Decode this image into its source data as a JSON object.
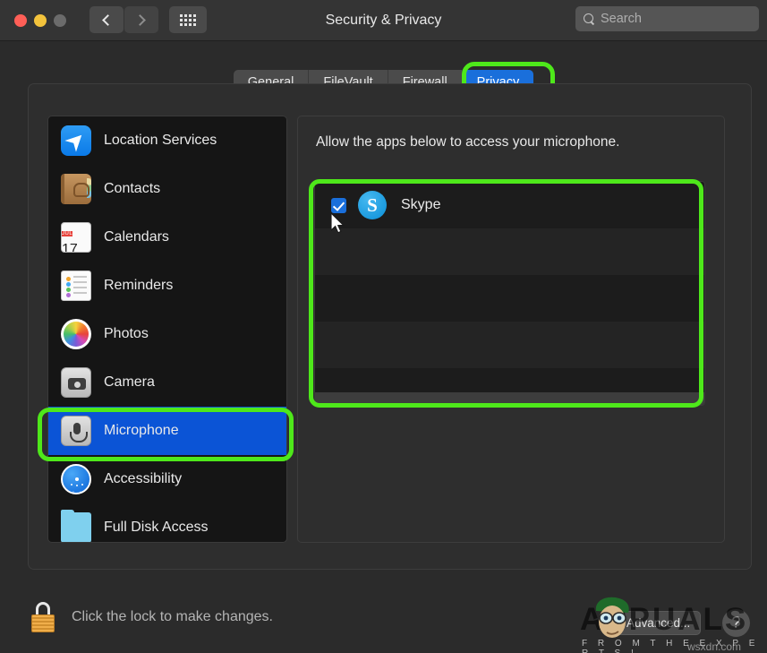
{
  "window": {
    "title": "Security & Privacy",
    "traffic_lights": [
      "close",
      "minimize",
      "zoom"
    ],
    "back_label": "Back",
    "forward_label": "Forward",
    "grid_label": "Show All"
  },
  "search": {
    "placeholder": "Search",
    "value": ""
  },
  "tabs": [
    {
      "label": "General",
      "active": false
    },
    {
      "label": "FileVault",
      "active": false
    },
    {
      "label": "Firewall",
      "active": false
    },
    {
      "label": "Privacy",
      "active": true
    }
  ],
  "sidebar": {
    "items": [
      {
        "label": "Location Services",
        "icon": "location-arrow-icon",
        "selected": false
      },
      {
        "label": "Contacts",
        "icon": "contacts-book-icon",
        "selected": false
      },
      {
        "label": "Calendars",
        "icon": "calendar-icon",
        "selected": false
      },
      {
        "label": "Reminders",
        "icon": "reminders-list-icon",
        "selected": false
      },
      {
        "label": "Photos",
        "icon": "photos-pinwheel-icon",
        "selected": false
      },
      {
        "label": "Camera",
        "icon": "camera-icon",
        "selected": false
      },
      {
        "label": "Microphone",
        "icon": "microphone-icon",
        "selected": true
      },
      {
        "label": "Accessibility",
        "icon": "accessibility-icon",
        "selected": false
      },
      {
        "label": "Full Disk Access",
        "icon": "folder-icon",
        "selected": false
      }
    ],
    "calendar_icon": {
      "month": "JUL",
      "day": "17"
    }
  },
  "main": {
    "description": "Allow the apps below to access your microphone.",
    "apps": [
      {
        "name": "Skype",
        "icon": "skype-icon",
        "icon_letter": "S",
        "checked": true
      }
    ]
  },
  "footer": {
    "lock_text": "Click the lock to make changes.",
    "lock_state": "unlocked",
    "advanced_label": "Advanced...",
    "help_label": "?"
  },
  "watermark": {
    "brand": "APPUALS",
    "tagline": "F R O M   T H E   E X P E R T S !",
    "url": "wsxdn.com"
  },
  "annotations": {
    "highlight_color": "#4ee81a",
    "targets": [
      "privacy-tab",
      "microphone-sidebar-item",
      "app-list"
    ]
  },
  "colors": {
    "accent_blue": "#1a6fdb",
    "selection_blue": "#0b54d6",
    "window_bg": "#2b2b2b",
    "panel_bg": "#2e2e2e",
    "sidebar_bg": "#151515"
  }
}
